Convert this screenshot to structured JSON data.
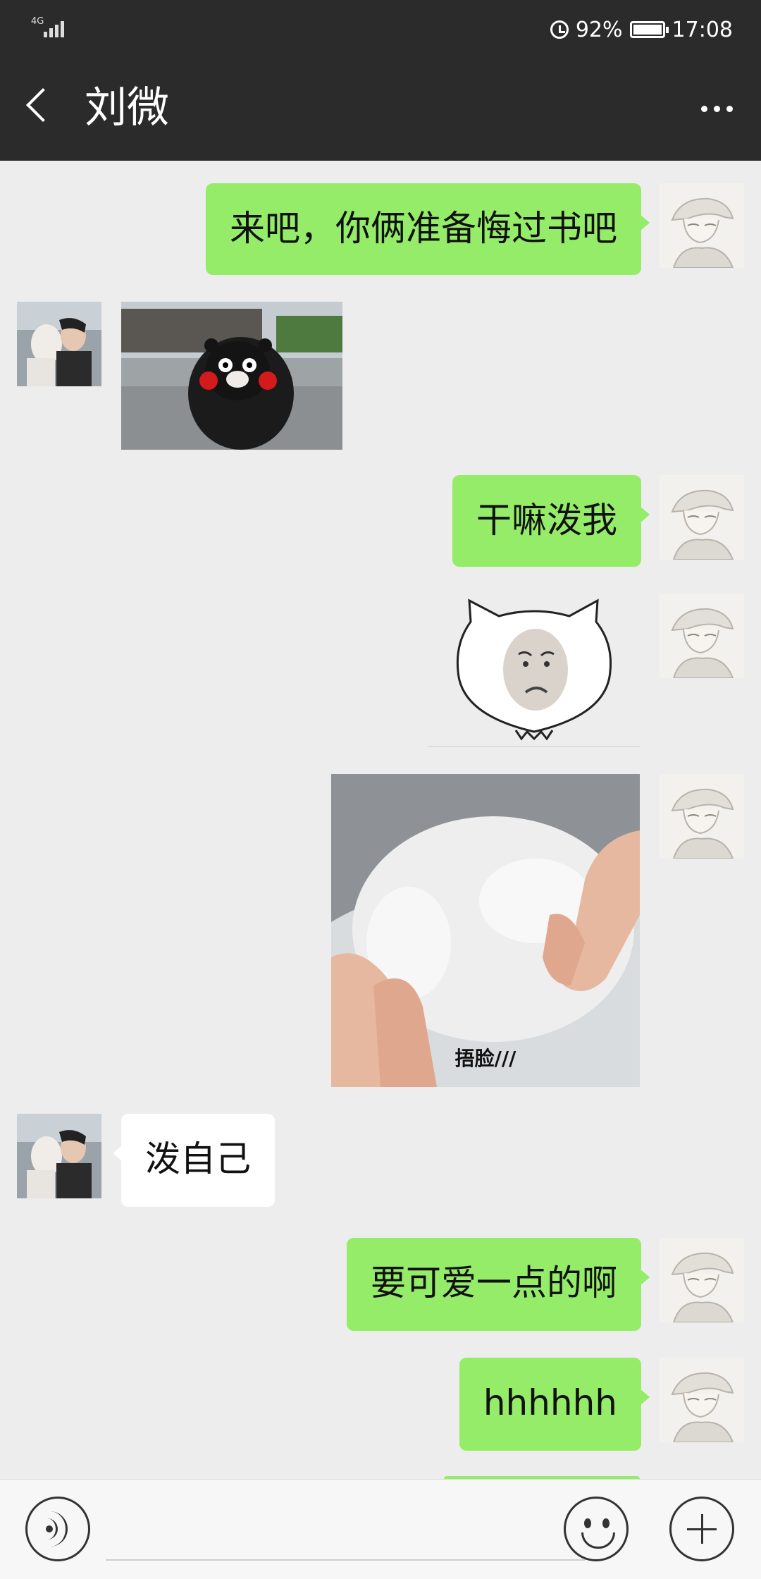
{
  "status_bar": {
    "network": "4G",
    "battery_percent": "92%",
    "time": "17:08"
  },
  "header": {
    "contact_name": "刘微"
  },
  "messages": [
    {
      "sender": "me",
      "type": "text",
      "text": "来吧，你俩准备悔过书吧"
    },
    {
      "sender": "them",
      "type": "image",
      "description_icon": "kumamon-photo"
    },
    {
      "sender": "me",
      "type": "text",
      "text": "干嘛泼我"
    },
    {
      "sender": "me",
      "type": "sticker",
      "description_icon": "pouting-cat-sticker"
    },
    {
      "sender": "me",
      "type": "image",
      "caption": "捂脸///"
    },
    {
      "sender": "them",
      "type": "text",
      "text": "泼自己"
    },
    {
      "sender": "me",
      "type": "text",
      "text": "要可爱一点的啊"
    },
    {
      "sender": "me",
      "type": "text",
      "text": "hhhhhh"
    }
  ],
  "colors": {
    "header_bg": "#2b2b2b",
    "chat_bg": "#ededed",
    "my_bubble": "#95ec69",
    "their_bubble": "#ffffff"
  }
}
